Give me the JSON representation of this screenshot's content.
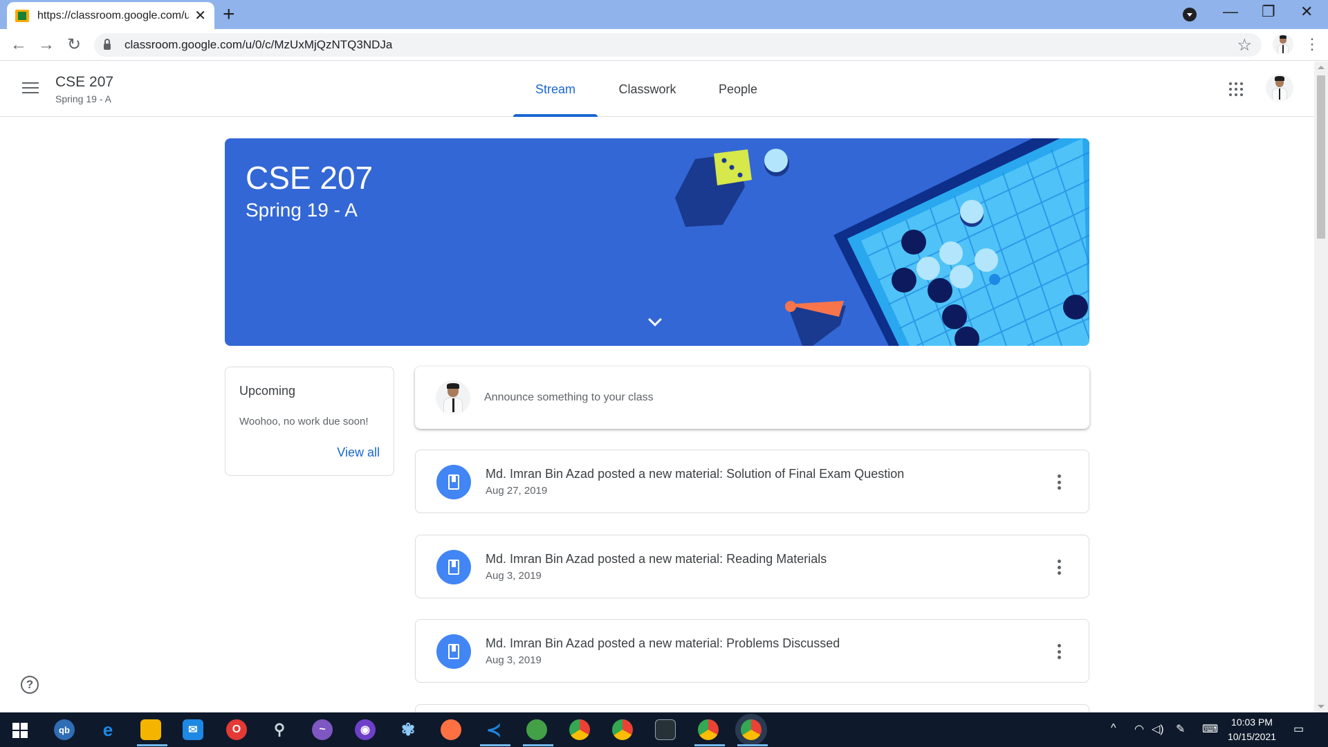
{
  "browser": {
    "tab_title": "https://classroom.google.com/u/",
    "url": "classroom.google.com/u/0/c/MzUxMjQzNTQ3NDJa",
    "icons": [
      "close-icon",
      "plus-icon",
      "back-icon",
      "forward-icon",
      "reload-icon",
      "lock-icon",
      "star-icon",
      "kebab-icon"
    ]
  },
  "appbar": {
    "course_title": "CSE 207",
    "course_subtitle": "Spring 19 - A",
    "tabs": [
      {
        "label": "Stream",
        "active": true
      },
      {
        "label": "Classwork",
        "active": false
      },
      {
        "label": "People",
        "active": false
      }
    ]
  },
  "banner": {
    "title": "CSE 207",
    "subtitle": "Spring 19 - A",
    "color": "#3367d6"
  },
  "upcoming": {
    "title": "Upcoming",
    "message": "Woohoo, no work due soon!",
    "view_all": "View all"
  },
  "announce": {
    "placeholder": "Announce something to your class"
  },
  "posts": [
    {
      "title": "Md. Imran Bin Azad posted a new material: Solution of Final Exam Question",
      "date": "Aug 27, 2019"
    },
    {
      "title": "Md. Imran Bin Azad posted a new material: Reading Materials",
      "date": "Aug 3, 2019"
    },
    {
      "title": "Md. Imran Bin Azad posted a new material: Problems Discussed",
      "date": "Aug 3, 2019"
    }
  ],
  "taskbar": {
    "time": "10:03 PM",
    "date": "10/15/2021",
    "apps": [
      "qb",
      "e",
      "folder",
      "mail",
      "opera",
      "satellite",
      "messenger",
      "github",
      "pinwheel",
      "firefox",
      "vscode",
      "earth",
      "chrome",
      "chrome",
      "terminal",
      "chrome-ek",
      "chrome-active"
    ]
  },
  "colors": {
    "accent": "#1967d2",
    "post_icon": "#4285f4"
  }
}
